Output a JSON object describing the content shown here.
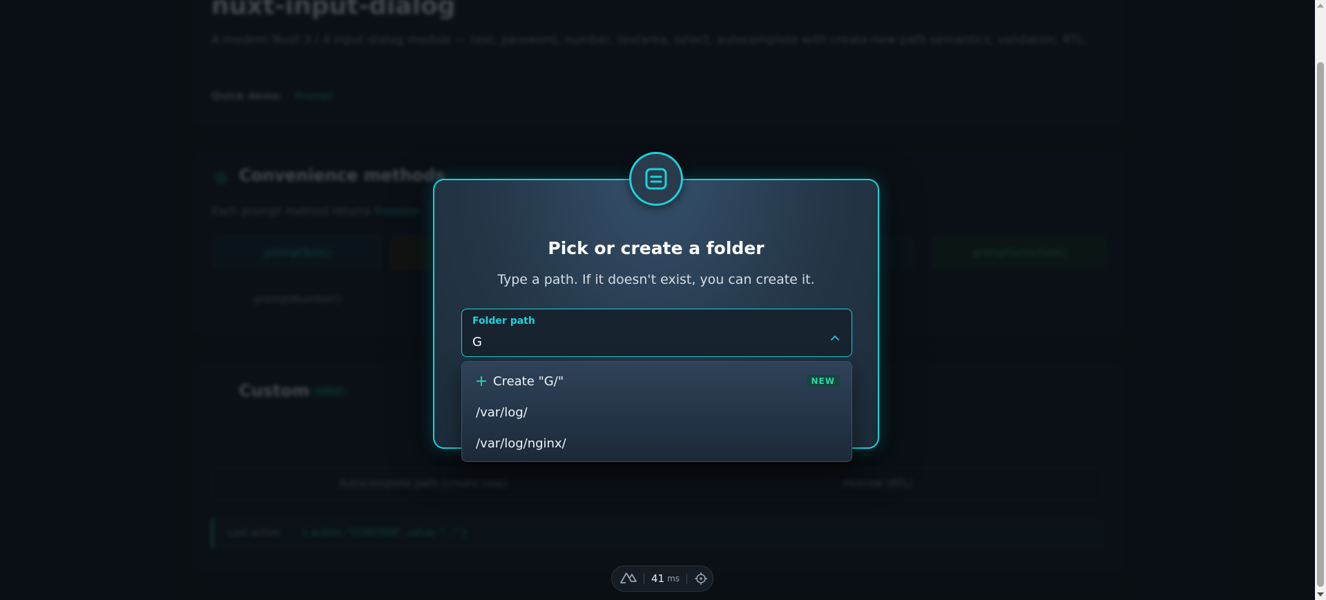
{
  "background": {
    "title": "nuxt-input-dialog",
    "description": "A modern Nuxt 3 / 4 input dialog module — text, password, number, textarea, select, autocomplete with create-new path semantics, validation, RTL.",
    "quick_demo_label": "Quick demo",
    "quick_demo_link": "Prompt",
    "section1_title": "Convenience methods",
    "section1_sub": "Each prompt method returns",
    "section1_sub_link": "Promise",
    "btn_a": "promptText()",
    "btn_b": "promptSelection()",
    "btn_c": "promptNumber()",
    "section2_title": "Custom",
    "section2_badge": "select",
    "row_left": "Autocomplete path (create new)",
    "row_right": "Hebrew (RTL)",
    "code_label": "Last action",
    "code_value": "{ action: \"CONFIRM\", value: \"...\" }"
  },
  "dialog": {
    "icon": "document-lines-icon",
    "title": "Pick or create a folder",
    "subtitle": "Type a path. If it doesn't exist, you can create it.",
    "field_label": "Folder path",
    "field_value": "G",
    "caret_icon": "chevron-up-icon"
  },
  "dropdown": {
    "create_label": "Create \"G/\"",
    "new_badge": "NEW",
    "options": [
      "/var/log/",
      "/var/log/nginx/"
    ]
  },
  "devtools": {
    "logo_icon": "nuxt-logo-icon",
    "render_time": "41",
    "render_unit": "ms",
    "inspect_icon": "target-icon"
  },
  "colors": {
    "accent": "#19d3de",
    "new_badge": "#2fd3a5",
    "page_bg": "#0f141b"
  }
}
